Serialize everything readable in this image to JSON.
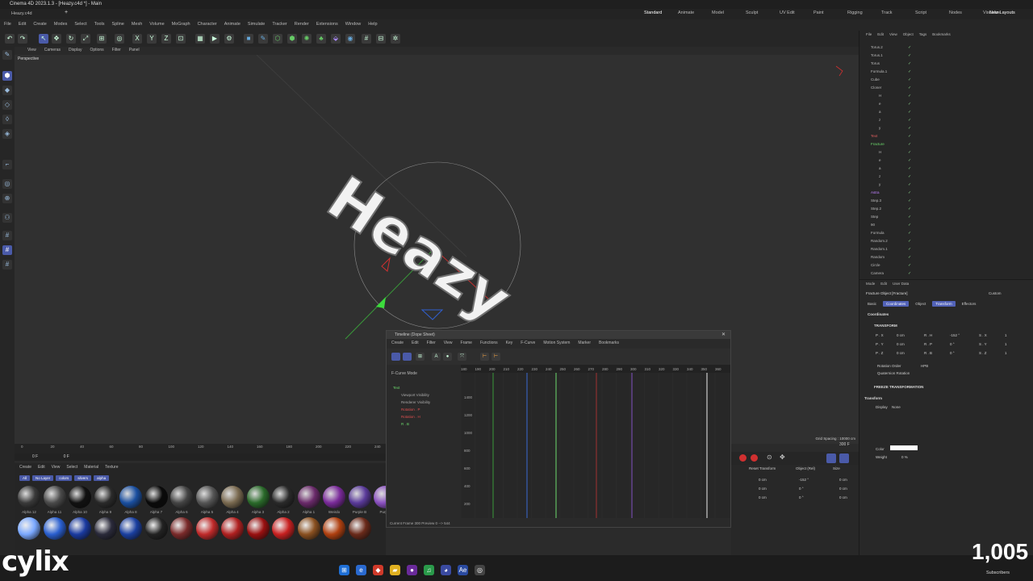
{
  "window_title": "Cinema 4D 2023.1.3 - [Heazy.c4d *] - Main",
  "file_tab": "Heazy.c4d",
  "menu": [
    "File",
    "Edit",
    "Create",
    "Modes",
    "Select",
    "Tools",
    "Spline",
    "Mesh",
    "Volume",
    "MoGraph",
    "Character",
    "Animate",
    "Simulate",
    "Tracker",
    "Render",
    "Extensions",
    "Window",
    "Help"
  ],
  "layouts": [
    "Standard",
    "Animate",
    "Model",
    "Sculpt",
    "UV Edit",
    "Paint",
    "Rigging",
    "Track",
    "Script",
    "Nodes",
    "Visualize"
  ],
  "new_layouts": "New Layouts",
  "viewport": {
    "menu": [
      "View",
      "Cameras",
      "Display",
      "Options",
      "Filter",
      "Panel"
    ],
    "label": "Perspective",
    "grid_spacing": "Grid Spacing : 10000 cm",
    "text_3d": "Heazy"
  },
  "ruler_ticks": [
    "0",
    "20",
    "40",
    "60",
    "80",
    "100",
    "120",
    "140",
    "160",
    "180",
    "200",
    "220",
    "240"
  ],
  "frame_start": "0 F",
  "frame_cur": "0 F",
  "frame_end": "300 F",
  "materials": {
    "menu": [
      "Create",
      "Edit",
      "View",
      "Select",
      "Material",
      "Texture"
    ],
    "filters": [
      "All",
      "No Layer",
      "colors",
      "silvers",
      "alpha"
    ],
    "row1": [
      "Alpha 12",
      "Alpha 11",
      "Alpha 10",
      "Alpha 9",
      "Alpha 8",
      "Alpha 7",
      "Alpha 6",
      "Alpha 5",
      "Alpha 4",
      "Alpha 3",
      "Alpha 2",
      "Alpha 1",
      "Weirdo",
      "Purple B",
      "Purple"
    ],
    "row1_colors": [
      "#3a3a3a",
      "#4a4a4a",
      "#111111",
      "#2a2a2a",
      "#1a4fa0",
      "#0a0a0a",
      "#444444",
      "#555555",
      "#7a6a50",
      "#2a6a2a",
      "#2a2a2a",
      "#6a2a6a",
      "#7a2a9a",
      "#5a3a9a",
      "#8a50c0"
    ],
    "row2_colors": [
      "#7aa8ff",
      "#2a5fcf",
      "#1a3aa0",
      "#2a2a3a",
      "#1a3fa0",
      "#222222",
      "#7a2a2a",
      "#c02a2a",
      "#b02020",
      "#9a1010",
      "#c82020",
      "#8a5020",
      "#b04010",
      "#6a2a1a"
    ]
  },
  "timeline": {
    "title": "Timeline (Dope Sheet)",
    "menu": [
      "Create",
      "Edit",
      "Filter",
      "View",
      "Frame",
      "Functions",
      "Key",
      "F-Curve",
      "Motion System",
      "Marker",
      "Bookmarks"
    ],
    "mode": "F-Curve Mode",
    "tree": [
      "Text",
      "Viewport Visibility",
      "Renderer Visibility",
      "Rotation . P",
      "Rotation . H",
      "R . B"
    ],
    "ticks": [
      "180",
      "190",
      "200",
      "210",
      "220",
      "230",
      "240",
      "250",
      "260",
      "270",
      "280",
      "290",
      "300",
      "310",
      "320",
      "330",
      "340",
      "350",
      "360"
    ],
    "y_ticks": [
      "1400",
      "1200",
      "1000",
      "800",
      "600",
      "400",
      "200"
    ],
    "status": "Current Frame 300 Preview 0 --> 544"
  },
  "objects": [
    {
      "name": "Torus.2",
      "cls": ""
    },
    {
      "name": "Torus.1",
      "cls": ""
    },
    {
      "name": "Torus",
      "cls": ""
    },
    {
      "name": "Formula.1",
      "cls": ""
    },
    {
      "name": "Cube",
      "cls": ""
    },
    {
      "name": "Cloner",
      "cls": ""
    },
    {
      "name": "H",
      "cls": ""
    },
    {
      "name": "e",
      "cls": ""
    },
    {
      "name": "a",
      "cls": ""
    },
    {
      "name": "z",
      "cls": ""
    },
    {
      "name": "y",
      "cls": ""
    },
    {
      "name": "Text",
      "cls": "red"
    },
    {
      "name": "Fracture",
      "cls": "green"
    },
    {
      "name": "H",
      "cls": ""
    },
    {
      "name": "e",
      "cls": ""
    },
    {
      "name": "a",
      "cls": ""
    },
    {
      "name": "z",
      "cls": ""
    },
    {
      "name": "y",
      "cls": ""
    },
    {
      "name": "Astra",
      "cls": "purple"
    },
    {
      "name": "Step.3",
      "cls": ""
    },
    {
      "name": "Step.2",
      "cls": ""
    },
    {
      "name": "Step",
      "cls": ""
    },
    {
      "name": "90",
      "cls": ""
    },
    {
      "name": "Formula",
      "cls": ""
    },
    {
      "name": "Random.2",
      "cls": ""
    },
    {
      "name": "Random.1",
      "cls": ""
    },
    {
      "name": "Random",
      "cls": ""
    },
    {
      "name": "Circle",
      "cls": ""
    },
    {
      "name": "Camera",
      "cls": ""
    }
  ],
  "om_menu": [
    "File",
    "Edit",
    "View",
    "Object",
    "Tags",
    "Bookmarks"
  ],
  "attributes": {
    "menu": [
      "Mode",
      "Edit",
      "User Data"
    ],
    "object_title": "Fracture Object [Fracture]",
    "preset": "Custom",
    "tabs": [
      "Basic",
      "Coordinates",
      "Object",
      "Transform",
      "Effectors"
    ],
    "section": "Coordinates",
    "transform": "TRANSFORM",
    "px": "0 cm",
    "py": "0 cm",
    "pz": "0 cm",
    "rh": "-152 °",
    "rp": "0 °",
    "rb": "0 °",
    "sx": "1",
    "sy": "1",
    "sz": "1",
    "rotation_order_label": "Rotation Order",
    "rotation_order": "HPB",
    "quaternion": "Quaternion Rotation",
    "freeze": "FREEZE TRANSFORMATION",
    "transform2": "Transform",
    "display_label": "Display",
    "display_val": "None",
    "color_label": "Color",
    "weight_label": "Weight",
    "weight_val": "0 %"
  },
  "coords_panel": {
    "reset": "Reset Transform",
    "mode": "Object (Rel)",
    "size": "Size",
    "rows": [
      [
        "0 cm",
        "-152 °",
        "0 cm"
      ],
      [
        "0 cm",
        "0 °",
        "0 cm"
      ],
      [
        "0 cm",
        "0 °",
        "0 cm"
      ]
    ]
  },
  "brand": "cylix",
  "subscribers_count": "1,005",
  "subscribers_label": "Subscribers"
}
